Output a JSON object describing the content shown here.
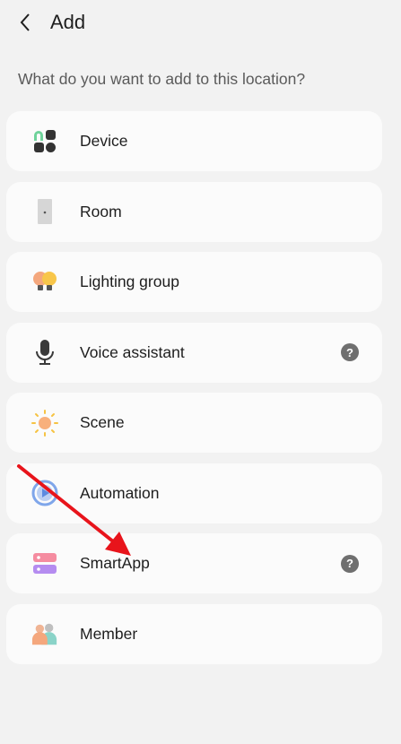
{
  "header": {
    "title": "Add"
  },
  "prompt": "What do you want to add to this location?",
  "items": [
    {
      "label": "Device",
      "icon": "device-icon"
    },
    {
      "label": "Room",
      "icon": "room-icon"
    },
    {
      "label": "Lighting group",
      "icon": "lighting-group-icon"
    },
    {
      "label": "Voice assistant",
      "icon": "microphone-icon",
      "help": "?"
    },
    {
      "label": "Scene",
      "icon": "scene-sun-icon"
    },
    {
      "label": "Automation",
      "icon": "automation-icon"
    },
    {
      "label": "SmartApp",
      "icon": "smartapp-icon",
      "help": "?"
    },
    {
      "label": "Member",
      "icon": "member-icon"
    }
  ],
  "annotation": {
    "arrow_color": "#e8141b"
  }
}
